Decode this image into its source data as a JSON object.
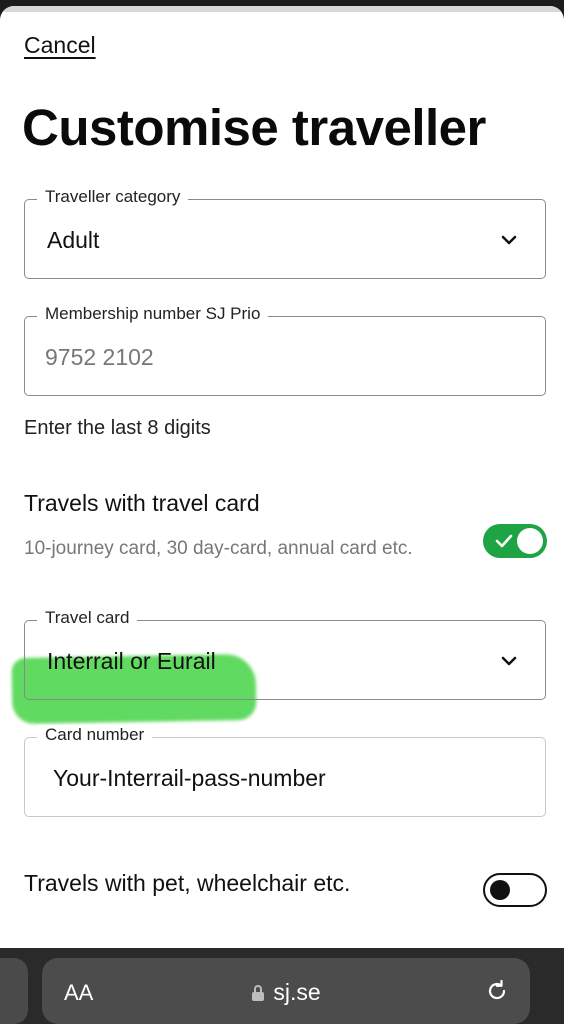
{
  "header": {
    "cancel_label": "Cancel",
    "title": "Customise traveller"
  },
  "traveller_category": {
    "legend": "Traveller category",
    "value": "Adult"
  },
  "membership": {
    "legend": "Membership number SJ Prio",
    "value": "9752 2102",
    "helper": "Enter the last 8 digits"
  },
  "travel_card_toggle": {
    "title": "Travels with travel card",
    "subtitle": "10-journey card, 30 day-card, annual card etc.",
    "on": true,
    "on_color": "#1ea345"
  },
  "travel_card": {
    "legend": "Travel card",
    "value": "Interrail or Eurail"
  },
  "card_number": {
    "legend": "Card number",
    "value": "Your-Interrail-pass-number"
  },
  "assistance_toggle": {
    "title": "Travels with pet, wheelchair etc.",
    "on": false
  },
  "browser": {
    "text_size_label": "AA",
    "domain": "sj.se",
    "icons": [
      "lock-icon",
      "reload-icon"
    ]
  },
  "annotation": {
    "highlight_color": "#3fd23f"
  }
}
